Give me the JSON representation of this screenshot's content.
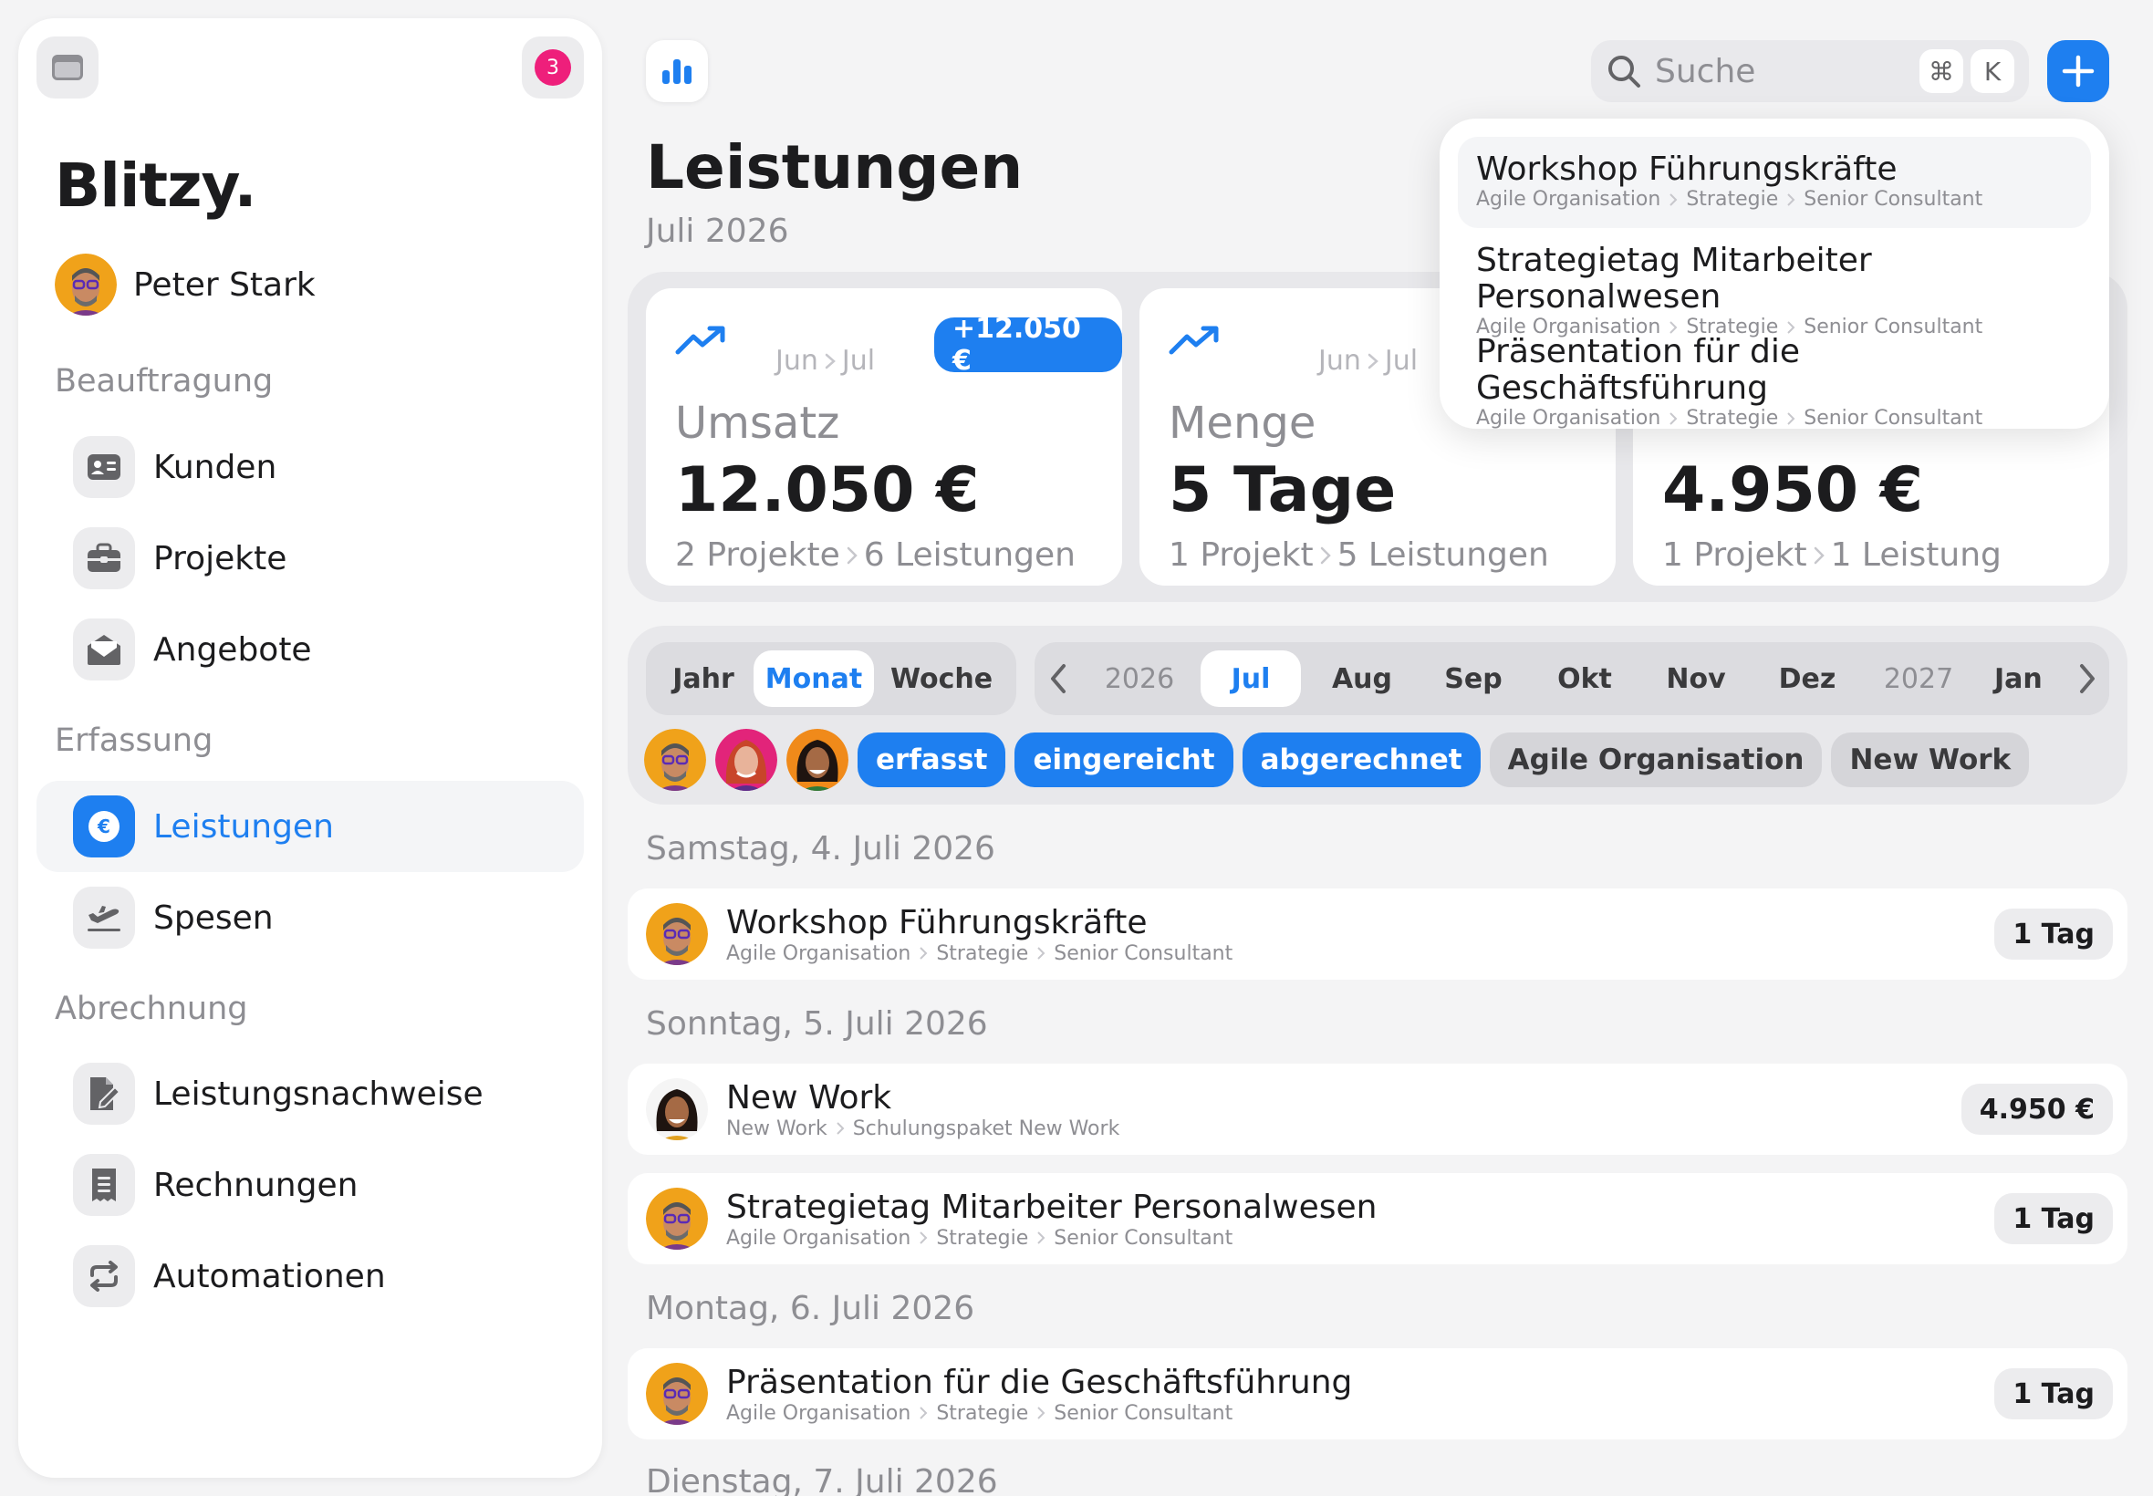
{
  "sidebar": {
    "notification_count": "3",
    "brand": "Blitzy.",
    "user_name": "Peter Stark",
    "sections": {
      "beauftragung": "Beauftragung",
      "erfassung": "Erfassung",
      "abrechnung": "Abrechnung"
    },
    "items": {
      "kunden": "Kunden",
      "projekte": "Projekte",
      "angebote": "Angebote",
      "leistungen": "Leistungen",
      "spesen": "Spesen",
      "leistungsnachweise": "Leistungsnachweise",
      "rechnungen": "Rechnungen",
      "automationen": "Automationen"
    },
    "active_item": "Leistungen"
  },
  "topbar": {
    "search_placeholder": "Suche",
    "shortcut_cmd": "⌘",
    "shortcut_key": "K"
  },
  "header": {
    "title": "Leistungen",
    "subtitle": "Juli 2026"
  },
  "stats": {
    "umsatz": {
      "period_from": "Jun",
      "period_to": "Jul",
      "delta": "+12.050 €",
      "label": "Umsatz",
      "value": "12.050 €",
      "detail_a": "2 Projekte",
      "detail_b": "6 Leistungen"
    },
    "menge": {
      "period_from": "Jun",
      "period_to": "Jul",
      "label": "Menge",
      "value": "5 Tage",
      "detail_a": "1 Projekt",
      "detail_b": "5 Leistungen"
    },
    "third": {
      "value": "4.950 €",
      "detail_a": "1 Projekt",
      "detail_b": "1 Leistung"
    }
  },
  "filters": {
    "granularity": [
      "Jahr",
      "Monat",
      "Woche"
    ],
    "granularity_active": "Monat",
    "months": [
      "2026",
      "Jul",
      "Aug",
      "Sep",
      "Okt",
      "Nov",
      "Dez",
      "2027",
      "Jan"
    ],
    "month_active": "Jul",
    "status_chips": [
      "erfasst",
      "eingereicht",
      "abgerechnet"
    ],
    "tag_chips": [
      "Agile Organisation",
      "New Work"
    ]
  },
  "days": [
    {
      "title": "Samstag, 4. Juli 2026",
      "entries": [
        {
          "title": "Workshop Führungskräfte",
          "crumbs": [
            "Agile Organisation",
            "Strategie",
            "Senior Consultant"
          ],
          "badge": "1 Tag",
          "avatar": "peter"
        }
      ]
    },
    {
      "title": "Sonntag, 5. Juli 2026",
      "entries": [
        {
          "title": "New Work",
          "crumbs": [
            "New Work",
            "Schulungspaket New Work"
          ],
          "badge": "4.950 €",
          "avatar": "woman2"
        },
        {
          "title": "Strategietag Mitarbeiter Personalwesen",
          "crumbs": [
            "Agile Organisation",
            "Strategie",
            "Senior Consultant"
          ],
          "badge": "1 Tag",
          "avatar": "peter"
        }
      ]
    },
    {
      "title": "Montag, 6. Juli 2026",
      "entries": [
        {
          "title": "Präsentation für die Geschäftsführung",
          "crumbs": [
            "Agile Organisation",
            "Strategie",
            "Senior Consultant"
          ],
          "badge": "1 Tag",
          "avatar": "peter"
        }
      ]
    },
    {
      "title": "Dienstag, 7. Juli 2026",
      "entries": []
    }
  ],
  "search_results": [
    {
      "title": "Workshop Führungskräfte",
      "crumbs": [
        "Agile Organisation",
        "Strategie",
        "Senior Consultant"
      ]
    },
    {
      "title": "Strategietag Mitarbeiter Personalwesen",
      "crumbs": [
        "Agile Organisation",
        "Strategie",
        "Senior Consultant"
      ]
    },
    {
      "title": "Präsentation für die Geschäftsführung",
      "crumbs": [
        "Agile Organisation",
        "Strategie",
        "Senior Consultant"
      ]
    }
  ],
  "colors": {
    "accent": "#1e7ff0",
    "badge": "#ee1f7b",
    "background": "#f4f4f5"
  },
  "icons": {
    "window": "window-icon",
    "chart": "bar-chart-icon",
    "search": "search-icon",
    "add": "plus-icon",
    "trend": "trend-up-icon"
  }
}
